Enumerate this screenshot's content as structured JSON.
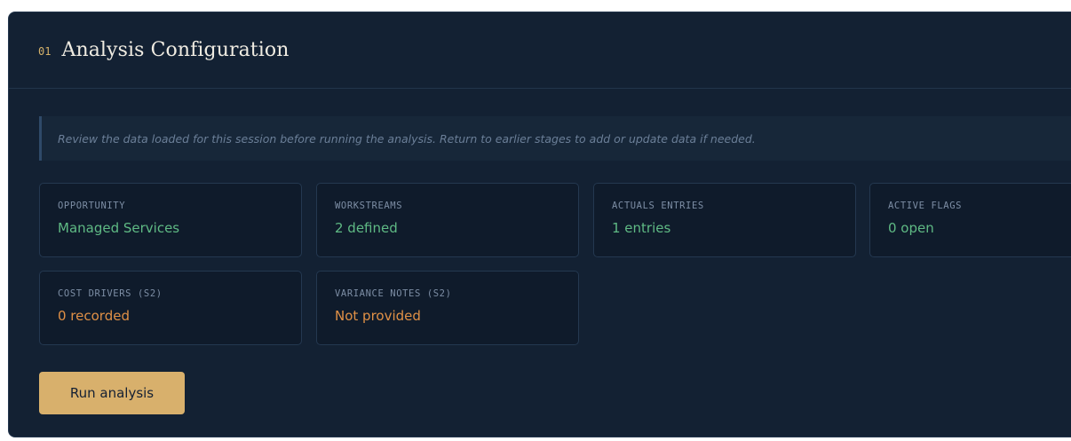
{
  "section": {
    "number": "01",
    "title": "Analysis Configuration"
  },
  "notice": {
    "text": "Review the data loaded for this session before running the analysis. Return to earlier stages to add or update data if needed."
  },
  "cards": [
    {
      "label": "OPPORTUNITY",
      "value": "Managed Services",
      "tone": "green"
    },
    {
      "label": "WORKSTREAMS",
      "value": "2 defined",
      "tone": "green"
    },
    {
      "label": "ACTUALS ENTRIES",
      "value": "1 entries",
      "tone": "green"
    },
    {
      "label": "ACTIVE FLAGS",
      "value": "0 open",
      "tone": "green"
    },
    {
      "label": "COST DRIVERS (S2)",
      "value": "0 recorded",
      "tone": "orange"
    },
    {
      "label": "VARIANCE NOTES (S2)",
      "value": "Not provided",
      "tone": "orange"
    }
  ],
  "actions": {
    "run_label": "Run analysis"
  },
  "colors": {
    "panel_bg": "#132133",
    "accent_gold": "#d8b06c",
    "value_ok": "#5fba84",
    "value_warn": "#e09046"
  }
}
